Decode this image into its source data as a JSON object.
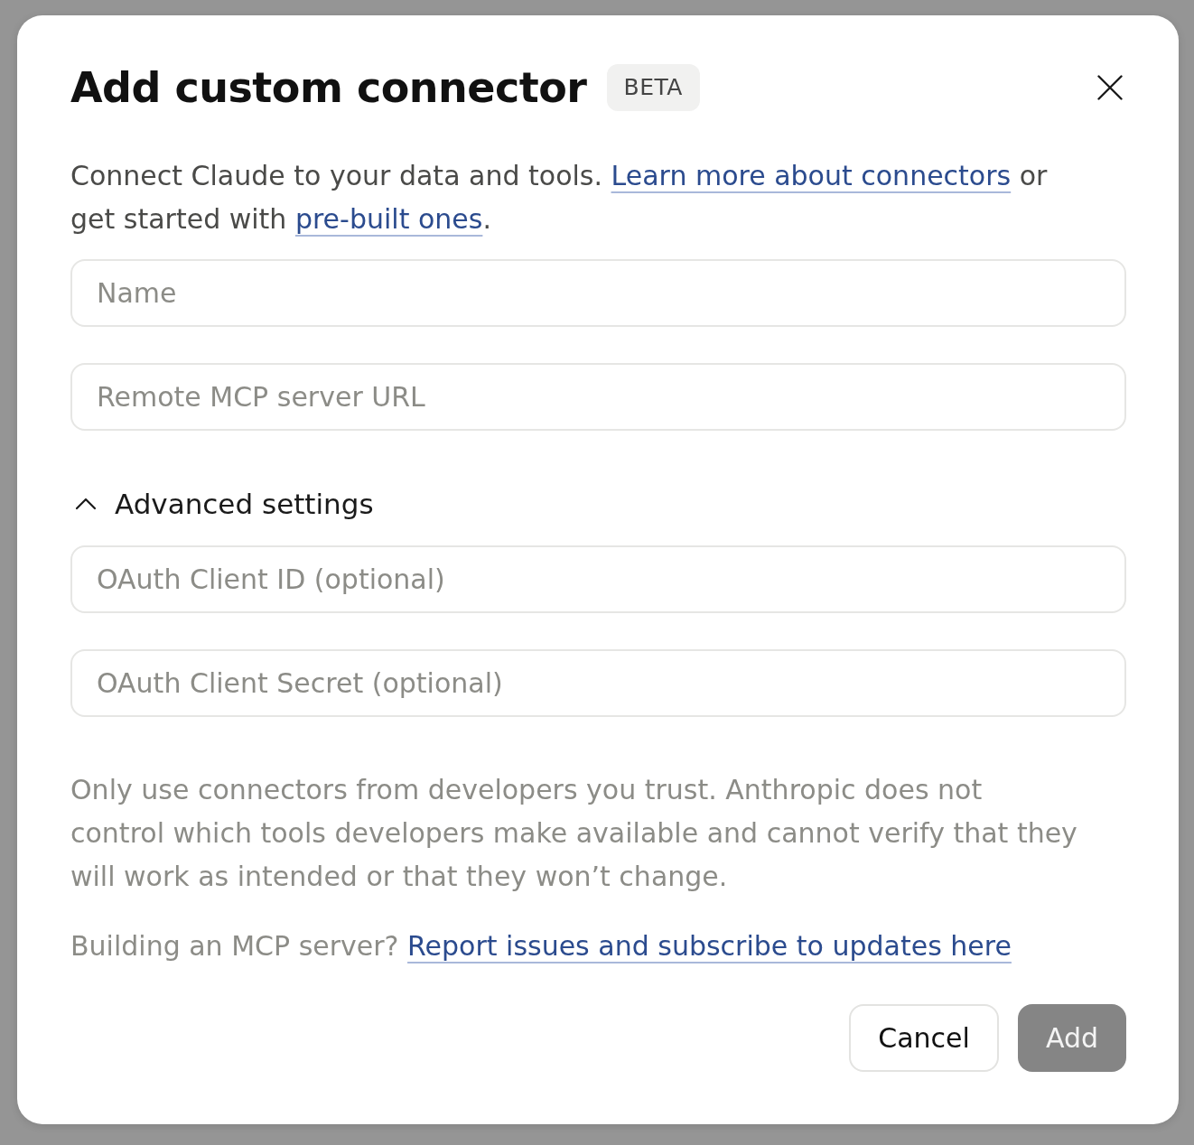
{
  "dialog": {
    "title": "Add custom connector",
    "badge": "BETA"
  },
  "intro": [
    {
      "kind": "text",
      "text": "Connect Claude to your data and tools. "
    },
    {
      "kind": "link",
      "text": "Learn more about connectors"
    },
    {
      "kind": "text",
      "text": " or get started with "
    },
    {
      "kind": "link",
      "text": "pre-built ones"
    },
    {
      "kind": "text",
      "text": "."
    }
  ],
  "fields": [
    {
      "placeholder": "Name"
    },
    {
      "placeholder": "Remote MCP server URL"
    }
  ],
  "advanced": {
    "label": "Advanced settings",
    "expanded": true,
    "fields": [
      {
        "placeholder": "OAuth Client ID (optional)"
      },
      {
        "placeholder": "OAuth Client Secret (optional)"
      }
    ]
  },
  "notice": "Only use connectors from developers you trust. Anthropic does not control which tools developers make available and cannot verify that they will work as intended or that they won’t change.",
  "footer_note": [
    {
      "kind": "text",
      "text": "Building an MCP server? "
    },
    {
      "kind": "link",
      "text": "Report issues and subscribe to updates here"
    }
  ],
  "buttons": [
    {
      "label": "Cancel",
      "kind": "cancel",
      "disabled": false
    },
    {
      "label": "Add",
      "kind": "add",
      "disabled": true
    }
  ]
}
